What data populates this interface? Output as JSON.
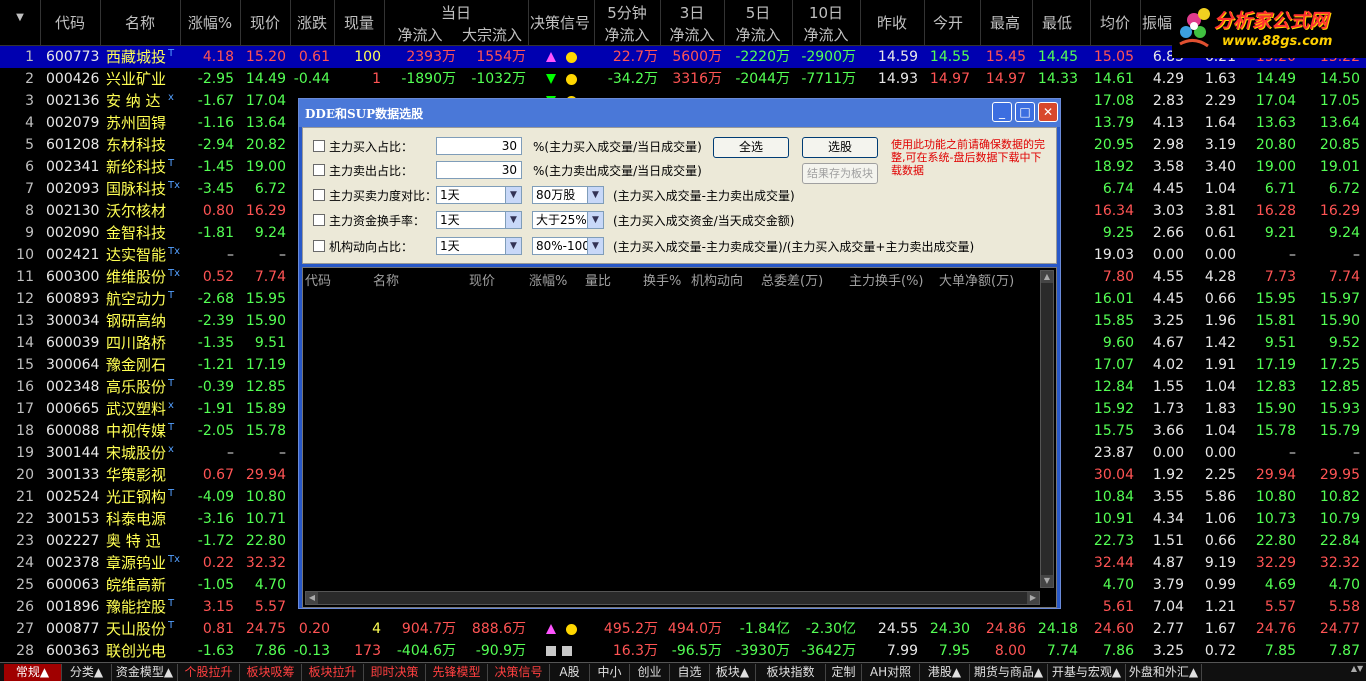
{
  "header": {
    "idx": "",
    "code": "代码",
    "name": "名称",
    "pct": "涨幅%",
    "price": "现价",
    "chg": "涨跌",
    "vol": "现量",
    "today_group": "当日",
    "today_net": "净流入",
    "today_big": "大宗流入",
    "signal": "决策信号",
    "m5_group": "5分钟",
    "m5_net": "净流入",
    "d3_group": "3日",
    "d3_net": "净流入",
    "d5_group": "5日",
    "d5_net": "净流入",
    "d10_group": "10日",
    "d10_net": "净流入",
    "prevclose": "昨收",
    "open": "今开",
    "high": "最高",
    "low": "最低",
    "avg": "均价",
    "amp": "振幅"
  },
  "logo": {
    "title": "分析家公式网",
    "url": "www.88gs.com"
  },
  "rows": [
    {
      "i": "1",
      "code": "600773",
      "name": "西藏城投",
      "mark": "T",
      "pct": "4.18",
      "price": "15.20",
      "chg": "0.61",
      "vol": "100",
      "today_net": "2393万",
      "today_big": "1554万",
      "signal": "up",
      "m5": "22.7万",
      "d3": "5600万",
      "d5": "-2220万",
      "d10": "-2900万",
      "prev": "14.59",
      "open": "14.55",
      "high": "15.45",
      "low": "14.45",
      "avg": "15.05",
      "amp": "6.85",
      "c1": "6.21",
      "c2": "15.20",
      "c3": "15.22"
    },
    {
      "i": "2",
      "code": "000426",
      "name": "兴业矿业",
      "mark": "",
      "pct": "-2.95",
      "price": "14.49",
      "chg": "-0.44",
      "vol": "1",
      "today_net": "-1890万",
      "today_big": "-1032万",
      "signal": "down",
      "m5": "-34.2万",
      "d3": "3316万",
      "d5": "-2044万",
      "d10": "-7711万",
      "prev": "14.93",
      "open": "14.97",
      "high": "14.97",
      "low": "14.33",
      "avg": "14.61",
      "amp": "4.29",
      "c1": "1.63",
      "c2": "14.49",
      "c3": "14.50"
    },
    {
      "i": "3",
      "code": "002136",
      "name": "安 纳 达",
      "mark": "x",
      "pct": "-1.67",
      "price": "17.04",
      "chg": "",
      "vol": "",
      "today_net": "",
      "today_big": "",
      "signal": "down",
      "m5": "",
      "d3": "",
      "d5": "",
      "d10": "",
      "prev": "",
      "open": "",
      "high": "",
      "low": "",
      "avg": "17.08",
      "amp": "2.83",
      "c1": "2.29",
      "c2": "17.04",
      "c3": "17.05"
    },
    {
      "i": "4",
      "code": "002079",
      "name": "苏州固锝",
      "mark": "",
      "pct": "-1.16",
      "price": "13.64",
      "chg": "",
      "vol": "",
      "today_net": "",
      "today_big": "",
      "signal": "",
      "m5": "",
      "d3": "",
      "d5": "",
      "d10": "",
      "prev": "",
      "open": "",
      "high": "",
      "low": "",
      "avg": "13.79",
      "amp": "4.13",
      "c1": "1.64",
      "c2": "13.63",
      "c3": "13.64"
    },
    {
      "i": "5",
      "code": "601208",
      "name": "东材科技",
      "mark": "",
      "pct": "-2.94",
      "price": "20.82",
      "chg": "",
      "vol": "",
      "today_net": "",
      "today_big": "",
      "signal": "",
      "m5": "",
      "d3": "",
      "d5": "",
      "d10": "",
      "prev": "",
      "open": "",
      "high": "",
      "low": "",
      "avg": "20.95",
      "amp": "2.98",
      "c1": "3.19",
      "c2": "20.80",
      "c3": "20.85"
    },
    {
      "i": "6",
      "code": "002341",
      "name": "新纶科技",
      "mark": "T",
      "pct": "-1.45",
      "price": "19.00",
      "chg": "",
      "vol": "",
      "today_net": "",
      "today_big": "",
      "signal": "",
      "m5": "",
      "d3": "",
      "d5": "",
      "d10": "",
      "prev": "",
      "open": "",
      "high": "",
      "low": "",
      "avg": "18.92",
      "amp": "3.58",
      "c1": "3.40",
      "c2": "19.00",
      "c3": "19.01"
    },
    {
      "i": "7",
      "code": "002093",
      "name": "国脉科技",
      "mark": "Tx",
      "pct": "-3.45",
      "price": "6.72",
      "chg": "",
      "vol": "",
      "today_net": "",
      "today_big": "",
      "signal": "",
      "m5": "",
      "d3": "",
      "d5": "",
      "d10": "",
      "prev": "",
      "open": "",
      "high": "",
      "low": "",
      "avg": "6.74",
      "amp": "4.45",
      "c1": "1.04",
      "c2": "6.71",
      "c3": "6.72"
    },
    {
      "i": "8",
      "code": "002130",
      "name": "沃尔核材",
      "mark": "",
      "pct": "0.80",
      "price": "16.29",
      "chg": "",
      "vol": "",
      "today_net": "",
      "today_big": "",
      "signal": "",
      "m5": "",
      "d3": "",
      "d5": "",
      "d10": "",
      "prev": "",
      "open": "",
      "high": "",
      "low": "",
      "avg": "16.34",
      "amp": "3.03",
      "c1": "3.81",
      "c2": "16.28",
      "c3": "16.29"
    },
    {
      "i": "9",
      "code": "002090",
      "name": "金智科技",
      "mark": "",
      "pct": "-1.81",
      "price": "9.24",
      "chg": "",
      "vol": "",
      "today_net": "",
      "today_big": "",
      "signal": "",
      "m5": "",
      "d3": "",
      "d5": "",
      "d10": "",
      "prev": "",
      "open": "",
      "high": "",
      "low": "",
      "avg": "9.25",
      "amp": "2.66",
      "c1": "0.61",
      "c2": "9.21",
      "c3": "9.24"
    },
    {
      "i": "10",
      "code": "002421",
      "name": "达实智能",
      "mark": "Tx",
      "pct": "–",
      "price": "–",
      "chg": "",
      "vol": "",
      "today_net": "",
      "today_big": "",
      "signal": "",
      "m5": "",
      "d3": "",
      "d5": "",
      "d10": "",
      "prev": "",
      "open": "",
      "high": "",
      "low": "",
      "avg": "19.03",
      "amp": "0.00",
      "c1": "0.00",
      "c2": "–",
      "c3": "–"
    },
    {
      "i": "11",
      "code": "600300",
      "name": "维维股份",
      "mark": "Tx",
      "pct": "0.52",
      "price": "7.74",
      "chg": "",
      "vol": "",
      "today_net": "",
      "today_big": "",
      "signal": "",
      "m5": "",
      "d3": "",
      "d5": "",
      "d10": "",
      "prev": "",
      "open": "",
      "high": "",
      "low": "",
      "avg": "7.80",
      "amp": "4.55",
      "c1": "4.28",
      "c2": "7.73",
      "c3": "7.74"
    },
    {
      "i": "12",
      "code": "600893",
      "name": "航空动力",
      "mark": "T",
      "pct": "-2.68",
      "price": "15.95",
      "chg": "",
      "vol": "",
      "today_net": "",
      "today_big": "",
      "signal": "",
      "m5": "",
      "d3": "",
      "d5": "",
      "d10": "",
      "prev": "",
      "open": "",
      "high": "",
      "low": "",
      "avg": "16.01",
      "amp": "4.45",
      "c1": "0.66",
      "c2": "15.95",
      "c3": "15.97"
    },
    {
      "i": "13",
      "code": "300034",
      "name": "钢研高纳",
      "mark": "",
      "pct": "-2.39",
      "price": "15.90",
      "chg": "",
      "vol": "",
      "today_net": "",
      "today_big": "",
      "signal": "",
      "m5": "",
      "d3": "",
      "d5": "",
      "d10": "",
      "prev": "",
      "open": "",
      "high": "",
      "low": "",
      "avg": "15.85",
      "amp": "3.25",
      "c1": "1.96",
      "c2": "15.81",
      "c3": "15.90"
    },
    {
      "i": "14",
      "code": "600039",
      "name": "四川路桥",
      "mark": "",
      "pct": "-1.35",
      "price": "9.51",
      "chg": "",
      "vol": "",
      "today_net": "",
      "today_big": "",
      "signal": "",
      "m5": "",
      "d3": "",
      "d5": "",
      "d10": "",
      "prev": "",
      "open": "",
      "high": "",
      "low": "",
      "avg": "9.60",
      "amp": "4.67",
      "c1": "1.42",
      "c2": "9.51",
      "c3": "9.52"
    },
    {
      "i": "15",
      "code": "300064",
      "name": "豫金刚石",
      "mark": "",
      "pct": "-1.21",
      "price": "17.19",
      "chg": "",
      "vol": "",
      "today_net": "",
      "today_big": "",
      "signal": "",
      "m5": "",
      "d3": "",
      "d5": "",
      "d10": "",
      "prev": "",
      "open": "",
      "high": "",
      "low": "",
      "avg": "17.07",
      "amp": "4.02",
      "c1": "1.91",
      "c2": "17.19",
      "c3": "17.25"
    },
    {
      "i": "16",
      "code": "002348",
      "name": "高乐股份",
      "mark": "T",
      "pct": "-0.39",
      "price": "12.85",
      "chg": "",
      "vol": "",
      "today_net": "",
      "today_big": "",
      "signal": "",
      "m5": "",
      "d3": "",
      "d5": "",
      "d10": "",
      "prev": "",
      "open": "",
      "high": "",
      "low": "",
      "avg": "12.84",
      "amp": "1.55",
      "c1": "1.04",
      "c2": "12.83",
      "c3": "12.85"
    },
    {
      "i": "17",
      "code": "000665",
      "name": "武汉塑料",
      "mark": "x",
      "pct": "-1.91",
      "price": "15.89",
      "chg": "",
      "vol": "",
      "today_net": "",
      "today_big": "",
      "signal": "",
      "m5": "",
      "d3": "",
      "d5": "",
      "d10": "",
      "prev": "",
      "open": "",
      "high": "",
      "low": "",
      "avg": "15.92",
      "amp": "1.73",
      "c1": "1.83",
      "c2": "15.90",
      "c3": "15.93"
    },
    {
      "i": "18",
      "code": "600088",
      "name": "中视传媒",
      "mark": "T",
      "pct": "-2.05",
      "price": "15.78",
      "chg": "",
      "vol": "",
      "today_net": "",
      "today_big": "",
      "signal": "",
      "m5": "",
      "d3": "",
      "d5": "",
      "d10": "",
      "prev": "",
      "open": "",
      "high": "",
      "low": "",
      "avg": "15.75",
      "amp": "3.66",
      "c1": "1.04",
      "c2": "15.78",
      "c3": "15.79"
    },
    {
      "i": "19",
      "code": "300144",
      "name": "宋城股份",
      "mark": "x",
      "pct": "–",
      "price": "–",
      "chg": "",
      "vol": "",
      "today_net": "",
      "today_big": "",
      "signal": "",
      "m5": "",
      "d3": "",
      "d5": "",
      "d10": "",
      "prev": "",
      "open": "",
      "high": "",
      "low": "",
      "avg": "23.87",
      "amp": "0.00",
      "c1": "0.00",
      "c2": "–",
      "c3": "–"
    },
    {
      "i": "20",
      "code": "300133",
      "name": "华策影视",
      "mark": "",
      "pct": "0.67",
      "price": "29.94",
      "chg": "",
      "vol": "",
      "today_net": "",
      "today_big": "",
      "signal": "",
      "m5": "",
      "d3": "",
      "d5": "",
      "d10": "",
      "prev": "",
      "open": "",
      "high": "",
      "low": "",
      "avg": "30.04",
      "amp": "1.92",
      "c1": "2.25",
      "c2": "29.94",
      "c3": "29.95"
    },
    {
      "i": "21",
      "code": "002524",
      "name": "光正钢构",
      "mark": "T",
      "pct": "-4.09",
      "price": "10.80",
      "chg": "",
      "vol": "",
      "today_net": "",
      "today_big": "",
      "signal": "",
      "m5": "",
      "d3": "",
      "d5": "",
      "d10": "",
      "prev": "",
      "open": "",
      "high": "",
      "low": "",
      "avg": "10.84",
      "amp": "3.55",
      "c1": "5.86",
      "c2": "10.80",
      "c3": "10.82"
    },
    {
      "i": "22",
      "code": "300153",
      "name": "科泰电源",
      "mark": "",
      "pct": "-3.16",
      "price": "10.71",
      "chg": "",
      "vol": "",
      "today_net": "",
      "today_big": "",
      "signal": "",
      "m5": "",
      "d3": "",
      "d5": "",
      "d10": "",
      "prev": "",
      "open": "",
      "high": "",
      "low": "",
      "avg": "10.91",
      "amp": "4.34",
      "c1": "1.06",
      "c2": "10.73",
      "c3": "10.79"
    },
    {
      "i": "23",
      "code": "002227",
      "name": "奥 特 迅",
      "mark": "",
      "pct": "-1.72",
      "price": "22.80",
      "chg": "",
      "vol": "",
      "today_net": "",
      "today_big": "",
      "signal": "",
      "m5": "",
      "d3": "",
      "d5": "",
      "d10": "",
      "prev": "",
      "open": "",
      "high": "",
      "low": "",
      "avg": "22.73",
      "amp": "1.51",
      "c1": "0.66",
      "c2": "22.80",
      "c3": "22.84"
    },
    {
      "i": "24",
      "code": "002378",
      "name": "章源钨业",
      "mark": "Tx",
      "pct": "0.22",
      "price": "32.32",
      "chg": "",
      "vol": "",
      "today_net": "",
      "today_big": "",
      "signal": "",
      "m5": "",
      "d3": "",
      "d5": "",
      "d10": "",
      "prev": "",
      "open": "",
      "high": "",
      "low": "",
      "avg": "32.44",
      "amp": "4.87",
      "c1": "9.19",
      "c2": "32.29",
      "c3": "32.32"
    },
    {
      "i": "25",
      "code": "600063",
      "name": "皖维高新",
      "mark": "",
      "pct": "-1.05",
      "price": "4.70",
      "chg": "",
      "vol": "",
      "today_net": "",
      "today_big": "",
      "signal": "",
      "m5": "",
      "d3": "",
      "d5": "",
      "d10": "",
      "prev": "",
      "open": "",
      "high": "",
      "low": "",
      "avg": "4.70",
      "amp": "3.79",
      "c1": "0.99",
      "c2": "4.69",
      "c3": "4.70"
    },
    {
      "i": "26",
      "code": "001896",
      "name": "豫能控股",
      "mark": "T",
      "pct": "3.15",
      "price": "5.57",
      "chg": "",
      "vol": "",
      "today_net": "",
      "today_big": "",
      "signal": "",
      "m5": "",
      "d3": "",
      "d5": "",
      "d10": "",
      "prev": "",
      "open": "",
      "high": "",
      "low": "",
      "avg": "5.61",
      "amp": "7.04",
      "c1": "1.21",
      "c2": "5.57",
      "c3": "5.58"
    },
    {
      "i": "27",
      "code": "000877",
      "name": "天山股份",
      "mark": "T",
      "pct": "0.81",
      "price": "24.75",
      "chg": "0.20",
      "vol": "4",
      "today_net": "904.7万",
      "today_big": "888.6万",
      "signal": "up",
      "m5": "495.2万",
      "d3": "494.0万",
      "d5": "-1.84亿",
      "d10": "-2.30亿",
      "prev": "24.55",
      "open": "24.30",
      "high": "24.86",
      "low": "24.18",
      "avg": "24.60",
      "amp": "2.77",
      "c1": "1.67",
      "c2": "24.76",
      "c3": "24.77"
    },
    {
      "i": "28",
      "code": "600363",
      "name": "联创光电",
      "mark": "",
      "pct": "-1.63",
      "price": "7.86",
      "chg": "-0.13",
      "vol": "173",
      "today_net": "-404.6万",
      "today_big": "-90.9万",
      "signal": "gray",
      "m5": "16.3万",
      "d3": "-96.5万",
      "d5": "-3930万",
      "d10": "-3642万",
      "prev": "7.99",
      "open": "7.95",
      "high": "8.00",
      "low": "7.74",
      "avg": "7.86",
      "amp": "3.25",
      "c1": "0.72",
      "c2": "7.85",
      "c3": "7.87"
    }
  ],
  "dialog": {
    "title": "DDE和SUP数据选股",
    "rows": [
      {
        "label": "主力买入占比：",
        "value": "30",
        "desc": "%(主力买入成交量/当日成交量)"
      },
      {
        "label": "主力卖出占比：",
        "value": "30",
        "desc": "%(主力卖出成交量/当日成交量)"
      },
      {
        "label": "主力买卖力度对比：",
        "sel1": "1天",
        "sel2": "80万股",
        "desc": "(主力买入成交量-主力卖出成交量)"
      },
      {
        "label": "主力资金换手率：",
        "sel1": "1天",
        "sel2": "大于25%",
        "desc": "(主力买入成交资金/当天成交金额)"
      },
      {
        "label": "机构动向占比：",
        "sel1": "1天",
        "sel2": "80%-100%",
        "desc": "(主力买入成交量-主力卖成交量)/(主力买入成交量+主力卖出成交量)"
      }
    ],
    "btn_all": "全选",
    "btn_select": "选股",
    "btn_save": "结果存为板块",
    "note": "使用此功能之前请确保数据的完整,可在系统-盘后数据下载中下载数据",
    "list_headers": [
      "代码",
      "名称",
      "现价",
      "涨幅%",
      "量比",
      "换手%",
      "机构动向",
      "总委差(万)",
      "主力换手(%)",
      "大单净额(万)"
    ]
  },
  "tabs": [
    {
      "label": "常规▲",
      "style": "active"
    },
    {
      "label": "分类▲",
      "style": ""
    },
    {
      "label": "资金模型▲",
      "style": ""
    },
    {
      "label": "个股拉升",
      "style": "red"
    },
    {
      "label": "板块吸筹",
      "style": "red"
    },
    {
      "label": "板块拉升",
      "style": "red"
    },
    {
      "label": "即时决策",
      "style": "red"
    },
    {
      "label": "先锋模型",
      "style": "red"
    },
    {
      "label": "决策信号",
      "style": "red"
    },
    {
      "label": "A股",
      "style": ""
    },
    {
      "label": "中小",
      "style": ""
    },
    {
      "label": "创业",
      "style": ""
    },
    {
      "label": "自选",
      "style": ""
    },
    {
      "label": "板块▲",
      "style": ""
    },
    {
      "label": "板块指数",
      "style": ""
    },
    {
      "label": "定制",
      "style": ""
    },
    {
      "label": "AH对照",
      "style": ""
    },
    {
      "label": "港股▲",
      "style": ""
    },
    {
      "label": "期货与商品▲",
      "style": ""
    },
    {
      "label": "开基与宏观▲",
      "style": ""
    },
    {
      "label": "外盘和外汇▲",
      "style": ""
    }
  ]
}
